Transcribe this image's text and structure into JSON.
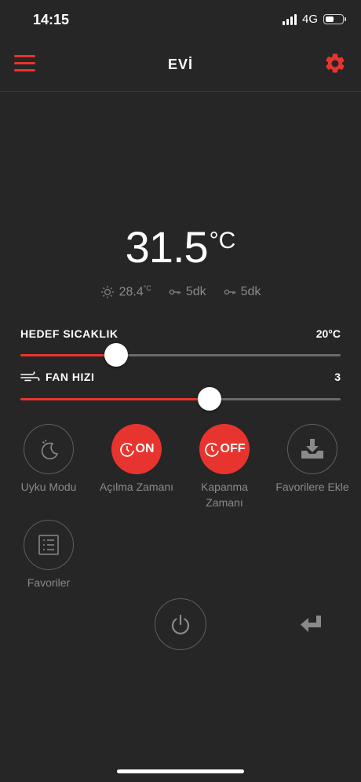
{
  "status_bar": {
    "time": "14:15",
    "network": "4G",
    "battery_level": 0.5
  },
  "header": {
    "title": "EVİ",
    "menu_icon": "hamburger-menu-icon",
    "settings_icon": "gear-icon"
  },
  "current_temp": {
    "value": "31.5",
    "unit": "°C"
  },
  "info": {
    "outdoor_temp": "28.4",
    "outdoor_unit": "°C",
    "timer_on": "5dk",
    "timer_off": "5dk"
  },
  "target_temp": {
    "label": "HEDEF SICAKLIK",
    "value_text": "20°C",
    "value": 20,
    "fraction": 0.3
  },
  "fan_speed": {
    "label": "FAN HIZI",
    "value_text": "3",
    "value": 3,
    "fraction": 0.59
  },
  "actions": {
    "sleep": {
      "label": "Uyku Modu"
    },
    "on_timer": {
      "label": "Açılma Zamanı",
      "badge": "ON"
    },
    "off_timer": {
      "label_line1": "Kapanma",
      "label_line2": "Zamanı",
      "badge": "OFF"
    },
    "add_favorite": {
      "label": "Favorilere Ekle"
    },
    "favorites": {
      "label": "Favoriler"
    }
  },
  "colors": {
    "accent": "#e8342f",
    "background": "#262626",
    "muted": "#8a8a8a"
  }
}
